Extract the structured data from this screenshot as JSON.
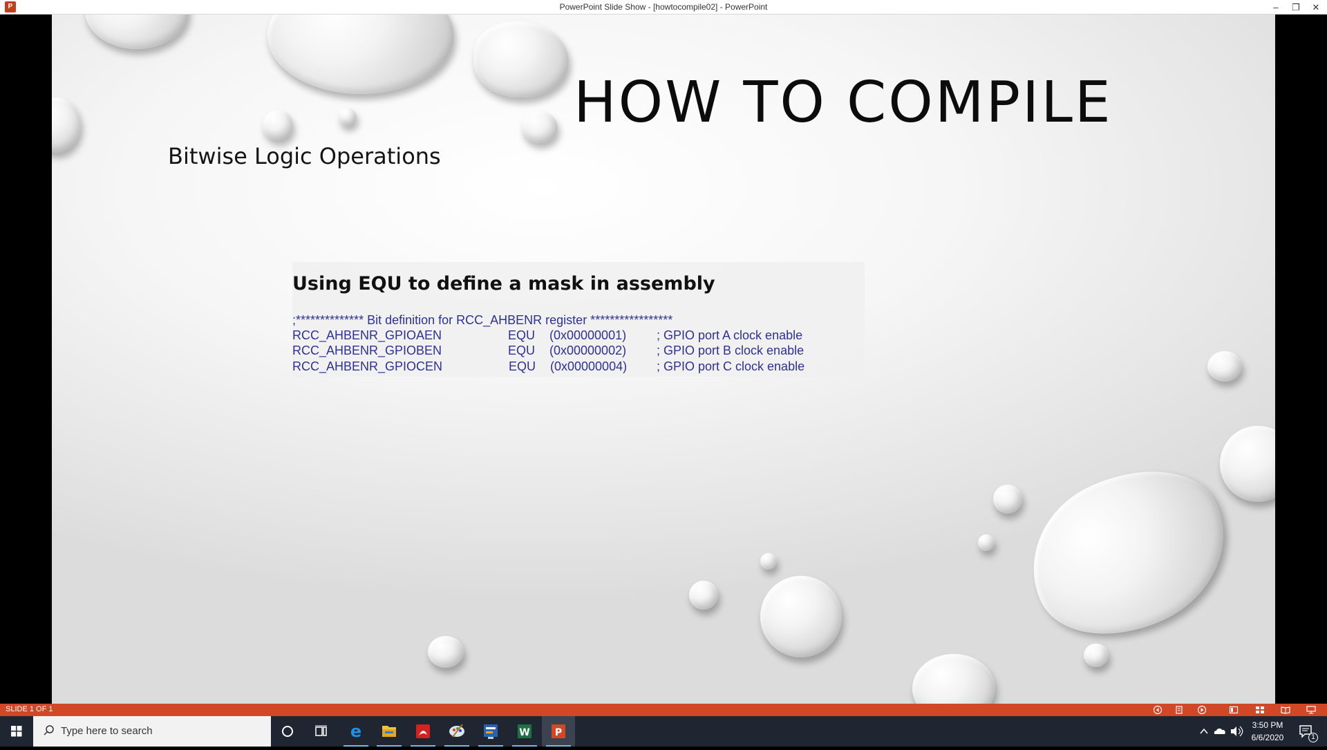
{
  "window": {
    "title": "PowerPoint Slide Show  -  [howtocompile02]  -  PowerPoint",
    "minimize_glyph": "–",
    "restore_glyph": "❐",
    "close_glyph": "✕"
  },
  "slide": {
    "title": "HOW TO COMPILE",
    "subtitle": "Bitwise Logic Operations",
    "code_heading": "Using EQU to define a mask in assembly",
    "code_comment": ";**************  Bit definition for RCC_AHBENR register  *****************",
    "code_lines": [
      {
        "name": "RCC_AHBENR_GPIOAEN",
        "op": "EQU",
        "value": "(0x00000001)",
        "comment": "; GPIO port A clock enable"
      },
      {
        "name": "RCC_AHBENR_GPIOBEN",
        "op": "EQU",
        "value": "(0x00000002)",
        "comment": "; GPIO port B clock enable"
      },
      {
        "name": "RCC_AHBENR_GPIOCEN",
        "op": "EQU",
        "value": "(0x00000004)",
        "comment": "; GPIO port C clock enable"
      }
    ]
  },
  "statusbar": {
    "slide_indicator": "SLIDE 1 OF 1",
    "icons": [
      "previous-icon",
      "notes-icon",
      "play-icon",
      "normal-view-icon",
      "slide-sorter-icon",
      "reading-view-icon",
      "slideshow-icon"
    ]
  },
  "taskbar": {
    "search_placeholder": "Type here to search",
    "apps": [
      "cortana-icon",
      "task-view-icon",
      "edge-icon",
      "file-explorer-icon",
      "acrobat-icon",
      "paint-icon",
      "keil-icon",
      "excel-app-icon",
      "powerpoint-icon"
    ],
    "time": "3:50 PM",
    "date": "6/6/2020",
    "notification_count": "1",
    "colors": {
      "taskbar": "#1f2631",
      "statusbar": "#d24726",
      "accent": "#2e3192"
    }
  }
}
